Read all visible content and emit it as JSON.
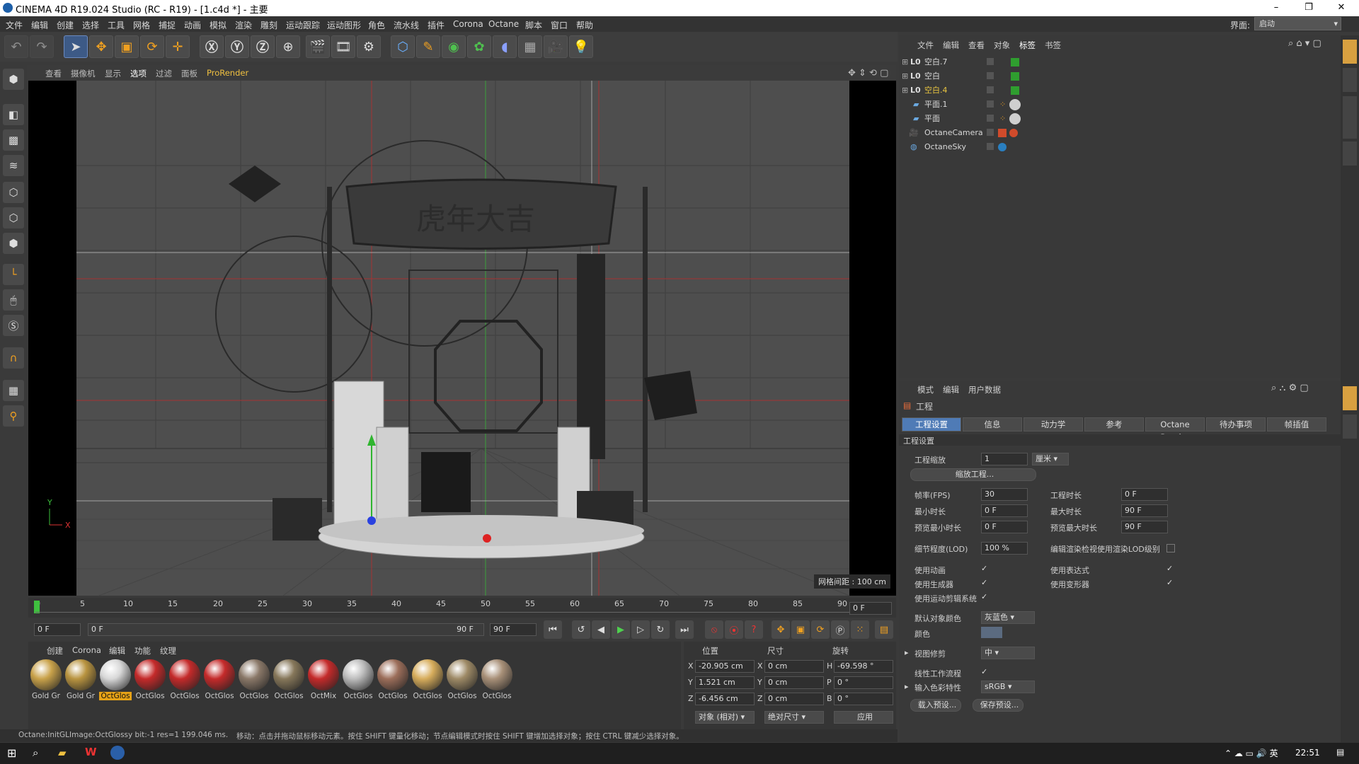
{
  "window": {
    "title": "CINEMA 4D R19.024 Studio (RC - R19) - [1.c4d *] - 主要",
    "minimize": "–",
    "maximize": "❐",
    "close": "✕"
  },
  "menu": [
    "文件",
    "编辑",
    "创建",
    "选择",
    "工具",
    "网格",
    "捕捉",
    "动画",
    "模拟",
    "渲染",
    "雕刻",
    "运动跟踪",
    "运动图形",
    "角色",
    "流水线",
    "插件",
    "Corona",
    "Octane",
    "脚本",
    "窗口",
    "帮助"
  ],
  "layout": {
    "label": "界面:",
    "value": "启动"
  },
  "viewport_menu": [
    "查看",
    "摄像机",
    "显示",
    "选项",
    "过滤",
    "面板",
    "ProRender"
  ],
  "viewport": {
    "grid_spacing": "网格间距 : 100 cm",
    "axis_y": "Y",
    "axis_x": "X",
    "banner_text": "虎年大吉"
  },
  "timeline": {
    "ticks": [
      "0",
      "5",
      "10",
      "15",
      "20",
      "25",
      "30",
      "35",
      "40",
      "45",
      "50",
      "55",
      "60",
      "65",
      "70",
      "75",
      "80",
      "85",
      "90"
    ],
    "end_frame": "0 F"
  },
  "transport": {
    "current": "0 F",
    "range_start": "0 F",
    "range_end": "90 F",
    "max": "90 F"
  },
  "materials": {
    "tabs": [
      "创建",
      "Corona",
      "编辑",
      "功能",
      "纹理"
    ],
    "items": [
      {
        "label": "Gold Gr",
        "color": "#c9a24a"
      },
      {
        "label": "Gold Gr",
        "color": "#b99440"
      },
      {
        "label": "OctGlos",
        "color": "#d8d8d8"
      },
      {
        "label": "OctGlos",
        "color": "#c42a2a"
      },
      {
        "label": "OctGlos",
        "color": "#c42a2a"
      },
      {
        "label": "OctGlos",
        "color": "#c42a2a"
      },
      {
        "label": "OctGlos",
        "color": "#8a7868"
      },
      {
        "label": "OctGlos",
        "color": "#86775a"
      },
      {
        "label": "OctMix",
        "color": "#c42a2a"
      },
      {
        "label": "OctGlos",
        "color": "#bdbdbd"
      },
      {
        "label": "OctGlos",
        "color": "#9c6e5a"
      },
      {
        "label": "OctGlos",
        "color": "#d7ad5c"
      },
      {
        "label": "OctGlos",
        "color": "#9e8a66"
      },
      {
        "label": "OctGlos",
        "color": "#a89078"
      }
    ]
  },
  "coords": {
    "headers": [
      "位置",
      "尺寸",
      "旋转"
    ],
    "rows": [
      {
        "a": "X",
        "pos": "-20.905 cm",
        "s": "X",
        "size": "0 cm",
        "r": "H",
        "rot": "-69.598 °"
      },
      {
        "a": "Y",
        "pos": "1.521 cm",
        "s": "Y",
        "size": "0 cm",
        "r": "P",
        "rot": "0 °"
      },
      {
        "a": "Z",
        "pos": "-6.456 cm",
        "s": "Z",
        "size": "0 cm",
        "r": "B",
        "rot": "0 °"
      }
    ],
    "mode": "对象 (相对)",
    "size_mode": "绝对尺寸",
    "apply": "应用"
  },
  "status": {
    "left": "Octane:InitGLImage:OctGlossy  bit:-1 res=1  199.046 ms.",
    "msg": "移动：点击并拖动鼠标移动元素。按住 SHIFT 键量化移动；节点编辑模式时按住 SHIFT 键增加选择对象；按住 CTRL 键减少选择对象。"
  },
  "object_manager": {
    "menu": [
      "文件",
      "编辑",
      "查看",
      "对象",
      "标签",
      "书签"
    ],
    "objects": [
      {
        "name": "空白.7",
        "color": "#d8d8d8",
        "tag": "#2f9e2f"
      },
      {
        "name": "空白",
        "color": "#d8d8d8",
        "tag": "#2f9e2f"
      },
      {
        "name": "空白.4",
        "color": "#e8c440",
        "tag": "#2f9e2f"
      },
      {
        "name": "平面.1",
        "color": "#d8d8d8",
        "tag": "#cfcfcf"
      },
      {
        "name": "平面",
        "color": "#d8d8d8",
        "tag": "#cfcfcf"
      },
      {
        "name": "OctaneCamera",
        "color": "#d8d8d8",
        "tag": "#d14b2b"
      },
      {
        "name": "OctaneSky",
        "color": "#d8d8d8",
        "tag": "#2a7fc0"
      }
    ]
  },
  "attributes": {
    "menu": [
      "模式",
      "编辑",
      "用户数据"
    ],
    "heading": "工程",
    "tabs": [
      "工程设置",
      "信息",
      "动力学",
      "参考",
      "Octane Render",
      "待办事项",
      "帧插值"
    ],
    "section": "工程设置",
    "scale_label": "工程缩放",
    "scale_value": "1",
    "scale_unit": "厘米",
    "scale_btn": "缩放工程...",
    "fps_label": "帧率(FPS)",
    "fps": "30",
    "time_label": "工程时长",
    "time": "0 F",
    "min_label": "最小时长",
    "min": "0 F",
    "max_label": "最大时长",
    "max": "90 F",
    "pmin_label": "预览最小时长",
    "pmin": "0 F",
    "pmax_label": "预览最大时长",
    "pmax": "90 F",
    "lod_label": "细节程度(LOD)",
    "lod": "100 %",
    "lod_check_label": "编辑渲染检视使用渲染LOD级别",
    "anim_label": "使用动画",
    "expr_label": "使用表达式",
    "gen_label": "使用生成器",
    "deform_label": "使用变形器",
    "motion_label": "使用运动剪辑系统",
    "color_label": "默认对象颜色",
    "color_value": "灰蓝色",
    "color2_label": "颜色",
    "clip_label": "视图修剪",
    "clip_value": "中",
    "linear_label": "线性工作流程",
    "input_label": "输入色彩特性",
    "input_value": "sRGB",
    "load_btn": "载入预设...",
    "save_btn": "保存预设..."
  },
  "taskbar": {
    "time": "22:51"
  }
}
